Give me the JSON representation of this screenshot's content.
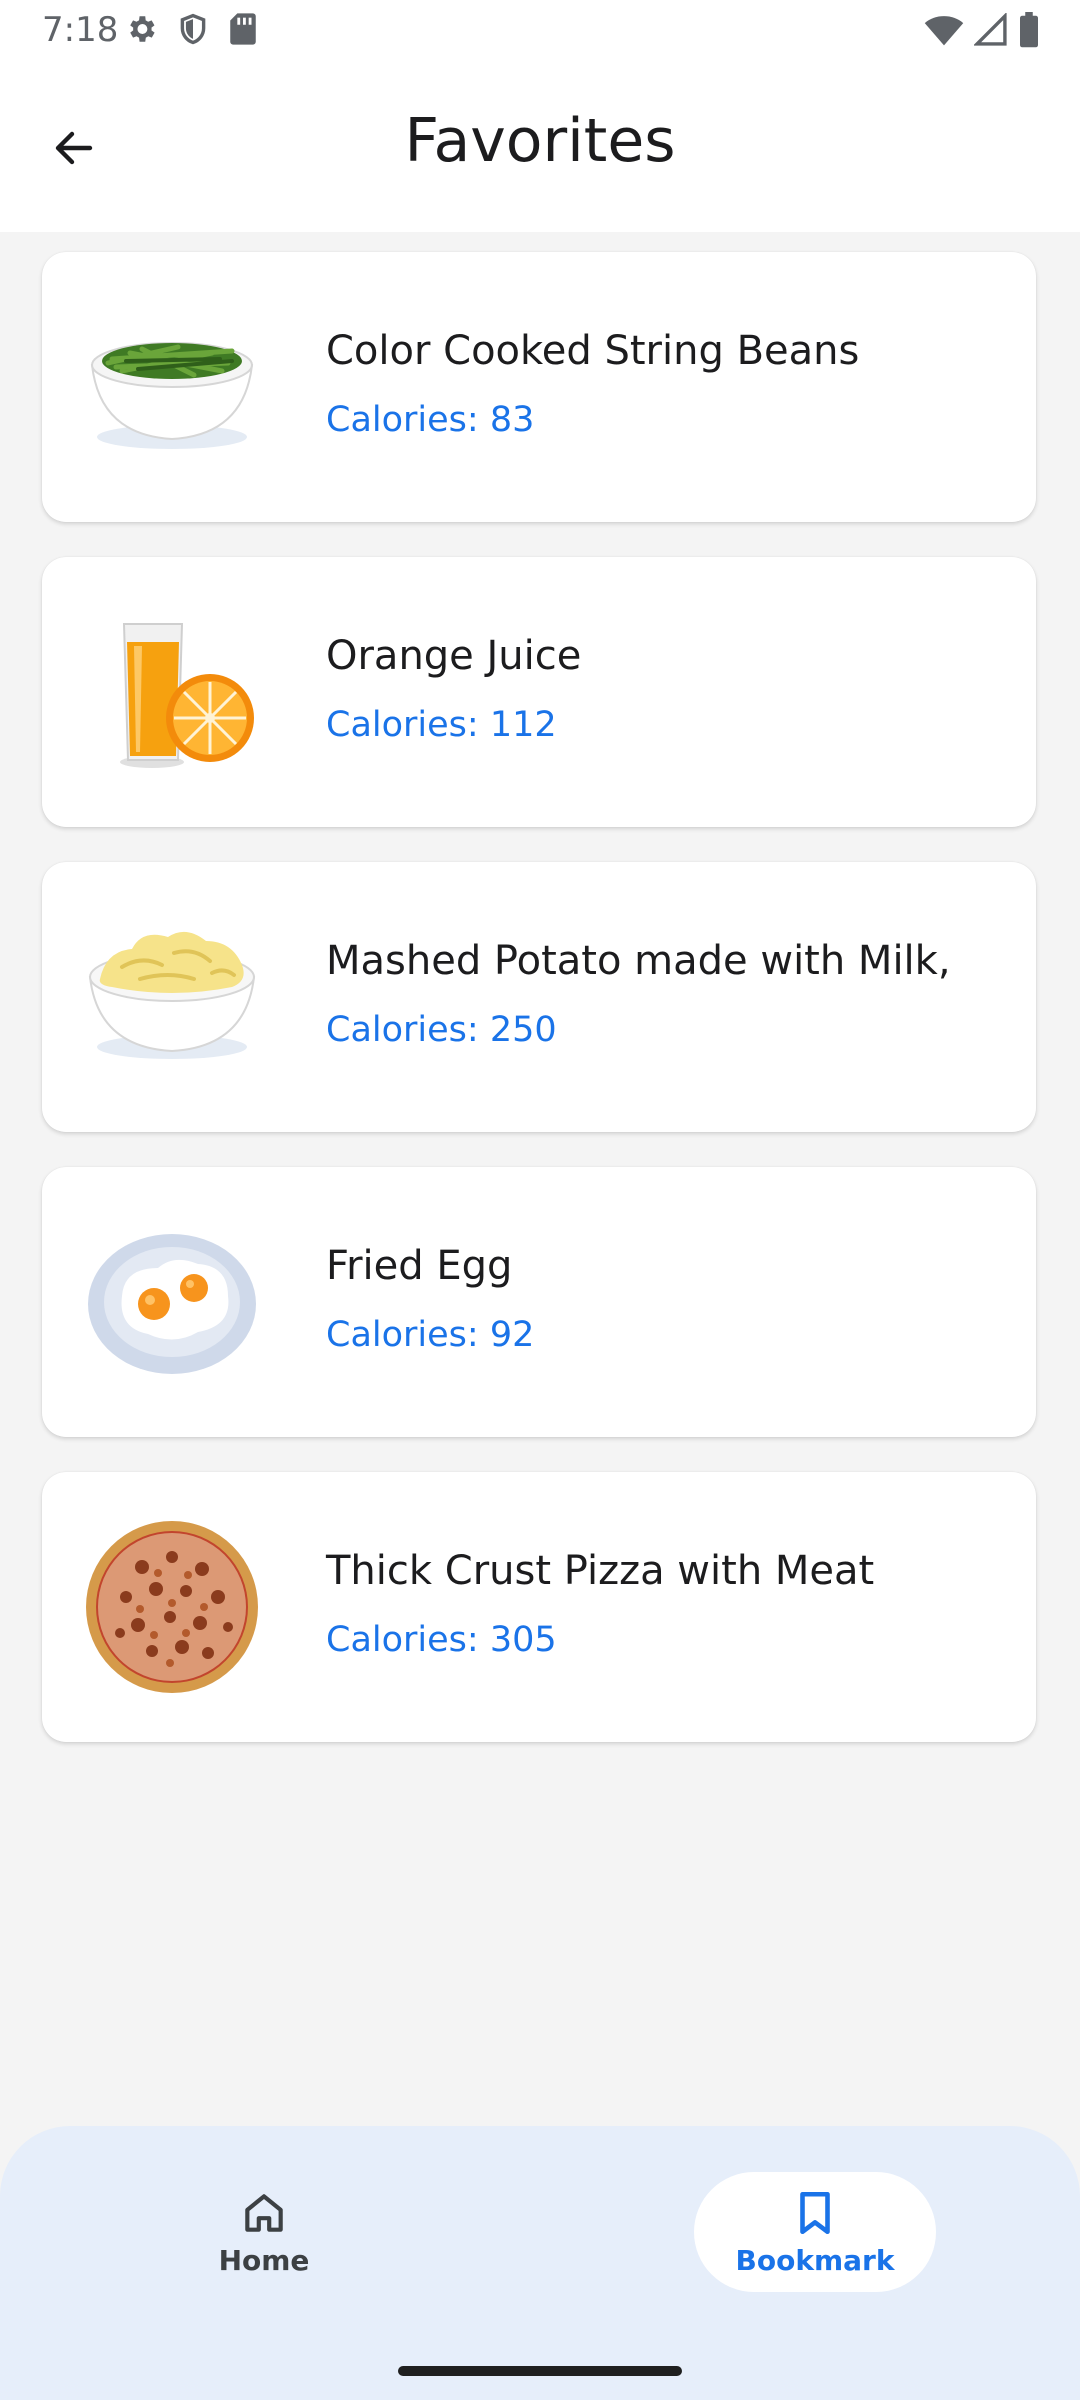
{
  "status_bar": {
    "time": "7:18",
    "icons_left": [
      "settings-icon",
      "shield-icon",
      "sd-card-icon"
    ],
    "icons_right": [
      "wifi-icon",
      "cell-signal-icon",
      "battery-icon"
    ]
  },
  "app_bar": {
    "title": "Favorites",
    "back_icon": "arrow-back-icon"
  },
  "favorites": [
    {
      "name": "Color Cooked String Beans",
      "calories": "Calories: 83",
      "image": "string-beans-bowl"
    },
    {
      "name": "Orange Juice",
      "calories": "Calories: 112",
      "image": "orange-juice-glass"
    },
    {
      "name": "Mashed Potato made with Milk,",
      "calories": "Calories: 250",
      "image": "mashed-potato-bowl"
    },
    {
      "name": "Fried Egg",
      "calories": "Calories: 92",
      "image": "fried-egg-plate"
    },
    {
      "name": "Thick Crust Pizza with Meat",
      "calories": "Calories: 305",
      "image": "meat-pizza"
    }
  ],
  "bottom_nav": {
    "items": [
      {
        "label": "Home",
        "icon": "home-icon",
        "selected": false
      },
      {
        "label": "Bookmark",
        "icon": "bookmark-icon",
        "selected": true
      }
    ]
  },
  "colors": {
    "accent": "#1a73e8",
    "nav_background": "#e6eefa",
    "page_background": "#f4f4f4"
  }
}
